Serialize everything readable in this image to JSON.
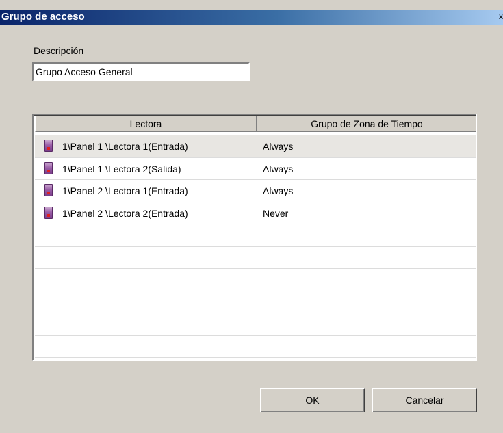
{
  "window": {
    "title": "Grupo de acceso",
    "close_glyph": "x"
  },
  "description": {
    "label": "Descripción",
    "value": "Grupo Acceso General"
  },
  "grid": {
    "columns": [
      "Lectora",
      "Grupo de Zona de Tiempo"
    ],
    "rows": [
      {
        "reader": "1\\Panel  1 \\Lectora  1(Entrada)",
        "zone": "Always",
        "icon": "reader-icon",
        "selected": true
      },
      {
        "reader": "1\\Panel  1 \\Lectora  2(Salida)",
        "zone": "Always",
        "icon": "reader-icon"
      },
      {
        "reader": "1\\Panel  2 \\Lectora  1(Entrada)",
        "zone": "Always",
        "icon": "reader-icon"
      },
      {
        "reader": "1\\Panel  2 \\Lectora  2(Entrada)",
        "zone": "Never",
        "icon": "reader-icon"
      },
      {
        "reader": "",
        "zone": ""
      },
      {
        "reader": "",
        "zone": ""
      },
      {
        "reader": "",
        "zone": ""
      },
      {
        "reader": "",
        "zone": ""
      },
      {
        "reader": "",
        "zone": ""
      },
      {
        "reader": "",
        "zone": ""
      }
    ]
  },
  "buttons": {
    "ok_label": "OK",
    "cancel_label": "Cancelar"
  },
  "colors": {
    "dialog_bg": "#d4d0c8",
    "titlebar_start": "#0a246a",
    "titlebar_end": "#a6caf0",
    "selected_row": "#e8e6e2"
  }
}
